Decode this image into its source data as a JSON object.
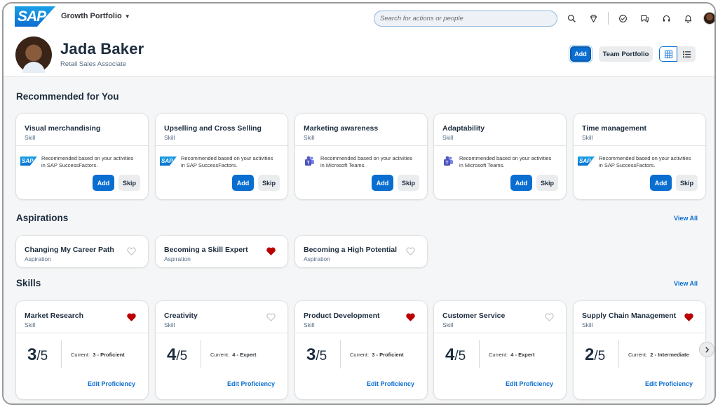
{
  "shell": {
    "logo": "SAP",
    "app_title": "Growth Portfolio",
    "search_placeholder": "Search for actions or people",
    "icons": [
      "search-icon",
      "diamond-icon",
      "checkmark-icon",
      "feedback-icon",
      "headset-icon",
      "bell-icon"
    ]
  },
  "header": {
    "name": "Jada Baker",
    "role": "Retail Sales Associate",
    "add_label": "Add",
    "team_portfolio_label": "Team Portfolio"
  },
  "colors": {
    "accent": "#0a6ed1",
    "heart_filled": "#bb0000",
    "heart_empty": "#c4c4c4",
    "text": "#1d2d3e"
  },
  "recommended": {
    "title": "Recommended for You",
    "cards": [
      {
        "title": "Visual merchandising",
        "type": "Skill",
        "source": "sap",
        "text_line1": "Recommended based on your activities",
        "text_line2": "in SAP SuccessFactors.",
        "add": "Add",
        "skip": "Skip"
      },
      {
        "title": "Upselling and Cross Selling",
        "type": "Skill",
        "source": "sap",
        "text_line1": "Recommended based on your activities",
        "text_line2": "in SAP SuccessFactors.",
        "add": "Add",
        "skip": "Skip"
      },
      {
        "title": "Marketing awareness",
        "type": "Skill",
        "source": "teams",
        "text_line1": "Recommended based on your activities",
        "text_line2": "in Microsoft Teams.",
        "add": "Add",
        "skip": "Skip"
      },
      {
        "title": "Adaptability",
        "type": "Skill",
        "source": "teams",
        "text_line1": "Recommended based on your activities",
        "text_line2": "in Microsoft Teams.",
        "add": "Add",
        "skip": "Skip"
      },
      {
        "title": "Time management",
        "type": "Skill",
        "source": "sap",
        "text_line1": "Recommended based on your activities",
        "text_line2": "in SAP SuccessFactors.",
        "add": "Add",
        "skip": "Skip"
      }
    ]
  },
  "aspirations": {
    "title": "Aspirations",
    "view_all": "View All",
    "cards": [
      {
        "title": "Changing My Career Path",
        "type": "Aspiration",
        "favorite": false
      },
      {
        "title": "Becoming a Skill Expert",
        "type": "Aspiration",
        "favorite": true
      },
      {
        "title": "Becoming a High Potential",
        "type": "Aspiration",
        "favorite": false
      }
    ]
  },
  "skills": {
    "title": "Skills",
    "view_all": "View All",
    "edit_label": "Edit Proficiency",
    "current_label": "Current:",
    "cards": [
      {
        "title": "Market Research",
        "type": "Skill",
        "favorite": true,
        "score": "3",
        "out_of": "/5",
        "current": "3 - Proficient"
      },
      {
        "title": "Creativity",
        "type": "Skill",
        "favorite": false,
        "score": "4",
        "out_of": "/5",
        "current": "4 - Expert"
      },
      {
        "title": "Product Development",
        "type": "Skill",
        "favorite": true,
        "score": "3",
        "out_of": "/5",
        "current": "3 - Proficient"
      },
      {
        "title": "Customer Service",
        "type": "Skill",
        "favorite": false,
        "score": "4",
        "out_of": "/5",
        "current": "4 - Expert"
      },
      {
        "title": "Supply Chain Management",
        "type": "Skill",
        "favorite": true,
        "score": "2",
        "out_of": "/5",
        "current": "2 - Intermediate"
      }
    ]
  }
}
